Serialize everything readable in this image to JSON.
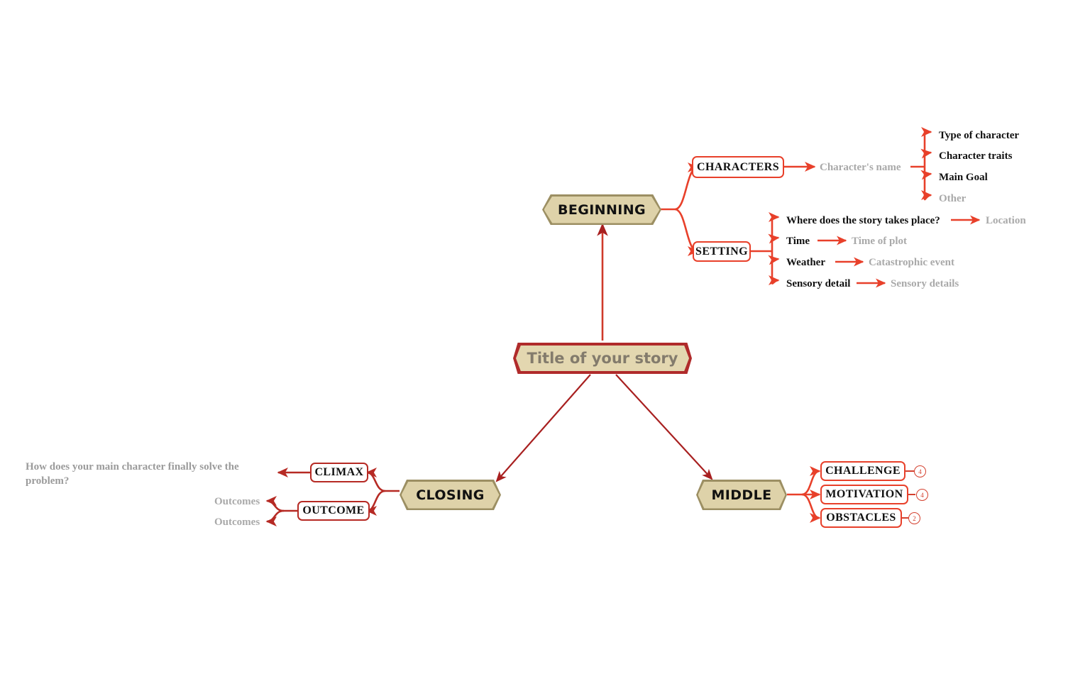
{
  "diagram": {
    "type": "mind-map",
    "title_node": {
      "label": "Title of your story",
      "shape": "hexagon",
      "fill": "#e3d7b0",
      "border": "#b02b2b",
      "text_color": "#837b6c"
    },
    "branch_style": {
      "fill": "#ded2a9",
      "border": "#9c8f63",
      "text_color": "#111111"
    },
    "subnode_style": {
      "fill": "#ffffff",
      "border": "#e8402a",
      "text_color": "#111111"
    },
    "connector_color": "#e8402a",
    "trunk_color": "#a82020",
    "placeholder_color": "#a9a9a9"
  },
  "branches": {
    "beginning": {
      "label": "BEGINNING",
      "children": [
        {
          "label": "CHARACTERS",
          "value": "Character's name",
          "value_style": "placeholder",
          "items": [
            {
              "label": "Type of character",
              "style": "filled"
            },
            {
              "label": "Character traits",
              "style": "filled"
            },
            {
              "label": "Main Goal",
              "style": "filled"
            },
            {
              "label": "Other",
              "style": "placeholder"
            }
          ]
        },
        {
          "label": "SETTING",
          "items": [
            {
              "label": "Where does the story takes place?",
              "value": "Location"
            },
            {
              "label": "Time",
              "value": "Time of plot"
            },
            {
              "label": "Weather",
              "value": "Catastrophic event"
            },
            {
              "label": "Sensory detail",
              "value": "Sensory details"
            }
          ]
        }
      ]
    },
    "middle": {
      "label": "MIDDLE",
      "children": [
        {
          "label": "CHALLENGE",
          "count": "4"
        },
        {
          "label": "MOTIVATION",
          "count": "4"
        },
        {
          "label": "OBSTACLES",
          "count": "2"
        }
      ]
    },
    "closing": {
      "label": "CLOSING",
      "children": [
        {
          "label": "CLIMAX",
          "value": "How does your main character finally solve the problem?"
        },
        {
          "label": "OUTCOME",
          "items": [
            {
              "label": "Outcomes"
            },
            {
              "label": "Outcomes"
            }
          ]
        }
      ]
    }
  }
}
